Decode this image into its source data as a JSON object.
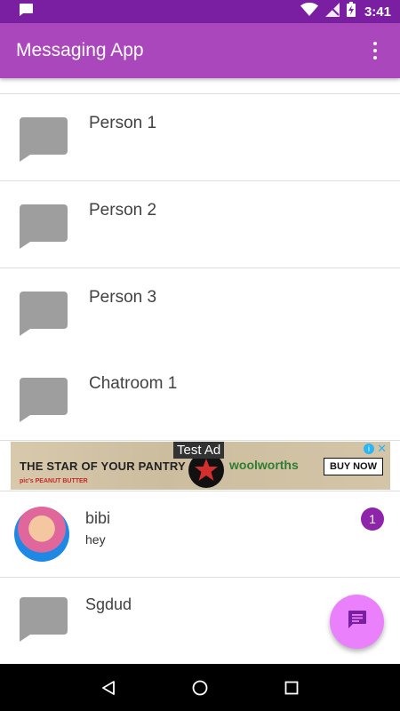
{
  "status_bar": {
    "time": "3:41",
    "icons": [
      "message-notification-icon",
      "wifi-icon",
      "no-signal-icon",
      "battery-charging-icon"
    ]
  },
  "app_bar": {
    "title": "Messaging App",
    "menu_icon": "overflow-menu-icon"
  },
  "conversations": [
    {
      "name": "Person 1",
      "icon": "chat-bubble-icon"
    },
    {
      "name": "Person 2",
      "icon": "chat-bubble-icon"
    },
    {
      "name": "Person 3",
      "icon": "chat-bubble-icon"
    },
    {
      "name": "Chatroom 1",
      "icon": "chat-bubble-icon"
    }
  ],
  "ad": {
    "label": "Test Ad",
    "headline": "THE STAR OF YOUR PANTRY",
    "sub": "pic's PEANUT BUTTER",
    "brand": "woolworths",
    "cta": "BUY NOW"
  },
  "chats": [
    {
      "name": "bibi",
      "preview": "hey",
      "unread": "1",
      "avatar": "avatar-image"
    },
    {
      "name": "Sgdud",
      "icon": "chat-bubble-icon"
    }
  ],
  "fab": {
    "icon": "new-message-icon"
  },
  "nav": {
    "icons": [
      "back-icon",
      "home-icon",
      "recents-icon"
    ]
  },
  "colors": {
    "primary": "#ab47bc",
    "primary_dark": "#7b1fa2",
    "accent": "#ea80fc",
    "badge": "#8e24aa",
    "chat_icon": "#9e9e9e"
  }
}
